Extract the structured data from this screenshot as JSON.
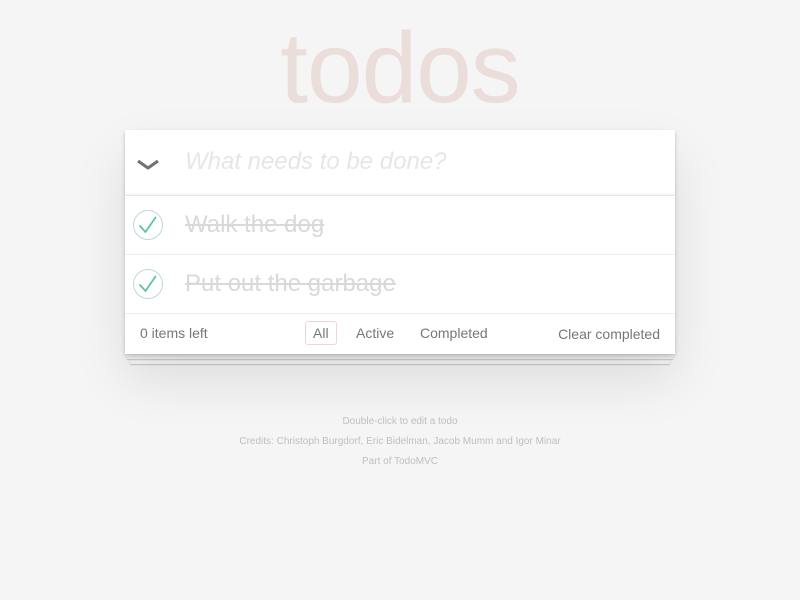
{
  "app": {
    "title": "todos"
  },
  "header": {
    "toggle_all_icon": "chevron-down-icon",
    "new_todo_placeholder": "What needs to be done?",
    "new_todo_value": ""
  },
  "todos": [
    {
      "label": "Walk the dog",
      "completed": true,
      "icon": "check-circle-icon"
    },
    {
      "label": "Put out the garbage",
      "completed": true,
      "icon": "check-circle-icon"
    }
  ],
  "footer": {
    "count_text": "0 items left",
    "filters": [
      {
        "label": "All",
        "selected": true
      },
      {
        "label": "Active",
        "selected": false
      },
      {
        "label": "Completed",
        "selected": false
      }
    ],
    "clear_completed_label": "Clear completed"
  },
  "info": {
    "edit_hint": "Double-click to edit a todo",
    "credits": "Credits: Christoph Burgdorf, Eric Bidelman, Jacob Mumm and Igor Minar",
    "part_of": "Part of TodoMVC"
  },
  "colors": {
    "background": "#f5f5f5",
    "title": "#eaddda",
    "check": "#5dc2af",
    "selected_filter_border": "#af2f2f"
  }
}
